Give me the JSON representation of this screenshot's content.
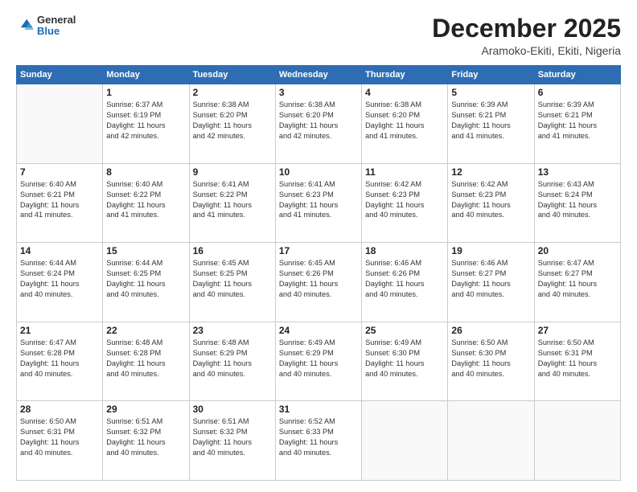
{
  "logo": {
    "general": "General",
    "blue": "Blue"
  },
  "header": {
    "month_year": "December 2025",
    "location": "Aramoko-Ekiti, Ekiti, Nigeria"
  },
  "days_of_week": [
    "Sunday",
    "Monday",
    "Tuesday",
    "Wednesday",
    "Thursday",
    "Friday",
    "Saturday"
  ],
  "weeks": [
    [
      {
        "day": "",
        "content": ""
      },
      {
        "day": "1",
        "content": "Sunrise: 6:37 AM\nSunset: 6:19 PM\nDaylight: 11 hours\nand 42 minutes."
      },
      {
        "day": "2",
        "content": "Sunrise: 6:38 AM\nSunset: 6:20 PM\nDaylight: 11 hours\nand 42 minutes."
      },
      {
        "day": "3",
        "content": "Sunrise: 6:38 AM\nSunset: 6:20 PM\nDaylight: 11 hours\nand 42 minutes."
      },
      {
        "day": "4",
        "content": "Sunrise: 6:38 AM\nSunset: 6:20 PM\nDaylight: 11 hours\nand 41 minutes."
      },
      {
        "day": "5",
        "content": "Sunrise: 6:39 AM\nSunset: 6:21 PM\nDaylight: 11 hours\nand 41 minutes."
      },
      {
        "day": "6",
        "content": "Sunrise: 6:39 AM\nSunset: 6:21 PM\nDaylight: 11 hours\nand 41 minutes."
      }
    ],
    [
      {
        "day": "7",
        "content": "Sunrise: 6:40 AM\nSunset: 6:21 PM\nDaylight: 11 hours\nand 41 minutes."
      },
      {
        "day": "8",
        "content": "Sunrise: 6:40 AM\nSunset: 6:22 PM\nDaylight: 11 hours\nand 41 minutes."
      },
      {
        "day": "9",
        "content": "Sunrise: 6:41 AM\nSunset: 6:22 PM\nDaylight: 11 hours\nand 41 minutes."
      },
      {
        "day": "10",
        "content": "Sunrise: 6:41 AM\nSunset: 6:23 PM\nDaylight: 11 hours\nand 41 minutes."
      },
      {
        "day": "11",
        "content": "Sunrise: 6:42 AM\nSunset: 6:23 PM\nDaylight: 11 hours\nand 40 minutes."
      },
      {
        "day": "12",
        "content": "Sunrise: 6:42 AM\nSunset: 6:23 PM\nDaylight: 11 hours\nand 40 minutes."
      },
      {
        "day": "13",
        "content": "Sunrise: 6:43 AM\nSunset: 6:24 PM\nDaylight: 11 hours\nand 40 minutes."
      }
    ],
    [
      {
        "day": "14",
        "content": "Sunrise: 6:44 AM\nSunset: 6:24 PM\nDaylight: 11 hours\nand 40 minutes."
      },
      {
        "day": "15",
        "content": "Sunrise: 6:44 AM\nSunset: 6:25 PM\nDaylight: 11 hours\nand 40 minutes."
      },
      {
        "day": "16",
        "content": "Sunrise: 6:45 AM\nSunset: 6:25 PM\nDaylight: 11 hours\nand 40 minutes."
      },
      {
        "day": "17",
        "content": "Sunrise: 6:45 AM\nSunset: 6:26 PM\nDaylight: 11 hours\nand 40 minutes."
      },
      {
        "day": "18",
        "content": "Sunrise: 6:46 AM\nSunset: 6:26 PM\nDaylight: 11 hours\nand 40 minutes."
      },
      {
        "day": "19",
        "content": "Sunrise: 6:46 AM\nSunset: 6:27 PM\nDaylight: 11 hours\nand 40 minutes."
      },
      {
        "day": "20",
        "content": "Sunrise: 6:47 AM\nSunset: 6:27 PM\nDaylight: 11 hours\nand 40 minutes."
      }
    ],
    [
      {
        "day": "21",
        "content": "Sunrise: 6:47 AM\nSunset: 6:28 PM\nDaylight: 11 hours\nand 40 minutes."
      },
      {
        "day": "22",
        "content": "Sunrise: 6:48 AM\nSunset: 6:28 PM\nDaylight: 11 hours\nand 40 minutes."
      },
      {
        "day": "23",
        "content": "Sunrise: 6:48 AM\nSunset: 6:29 PM\nDaylight: 11 hours\nand 40 minutes."
      },
      {
        "day": "24",
        "content": "Sunrise: 6:49 AM\nSunset: 6:29 PM\nDaylight: 11 hours\nand 40 minutes."
      },
      {
        "day": "25",
        "content": "Sunrise: 6:49 AM\nSunset: 6:30 PM\nDaylight: 11 hours\nand 40 minutes."
      },
      {
        "day": "26",
        "content": "Sunrise: 6:50 AM\nSunset: 6:30 PM\nDaylight: 11 hours\nand 40 minutes."
      },
      {
        "day": "27",
        "content": "Sunrise: 6:50 AM\nSunset: 6:31 PM\nDaylight: 11 hours\nand 40 minutes."
      }
    ],
    [
      {
        "day": "28",
        "content": "Sunrise: 6:50 AM\nSunset: 6:31 PM\nDaylight: 11 hours\nand 40 minutes."
      },
      {
        "day": "29",
        "content": "Sunrise: 6:51 AM\nSunset: 6:32 PM\nDaylight: 11 hours\nand 40 minutes."
      },
      {
        "day": "30",
        "content": "Sunrise: 6:51 AM\nSunset: 6:32 PM\nDaylight: 11 hours\nand 40 minutes."
      },
      {
        "day": "31",
        "content": "Sunrise: 6:52 AM\nSunset: 6:33 PM\nDaylight: 11 hours\nand 40 minutes."
      },
      {
        "day": "",
        "content": ""
      },
      {
        "day": "",
        "content": ""
      },
      {
        "day": "",
        "content": ""
      }
    ]
  ]
}
